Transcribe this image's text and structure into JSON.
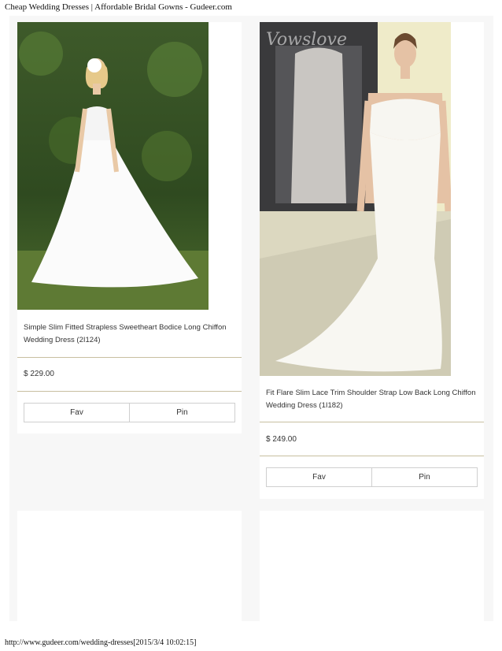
{
  "page": {
    "header_text": "Cheap Wedding Dresses | Affordable Bridal Gowns - Gudeer.com",
    "footer_text": "http://www.gudeer.com/wedding-dresses[2015/3/4 10:02:15]"
  },
  "products": [
    {
      "title": "Simple Slim Fitted Strapless Sweetheart Bodice Long Chiffon Wedding Dress (2I124)",
      "price": "$ 229.00",
      "fav_label": "Fav",
      "pin_label": "Pin"
    },
    {
      "title": "Fit Flare Slim Lace Trim Shoulder Strap Low Back Long Chiffon Wedding Dress (1I182)",
      "price": "$ 249.00",
      "fav_label": "Fav",
      "pin_label": "Pin",
      "watermark": "Vowslove"
    }
  ]
}
